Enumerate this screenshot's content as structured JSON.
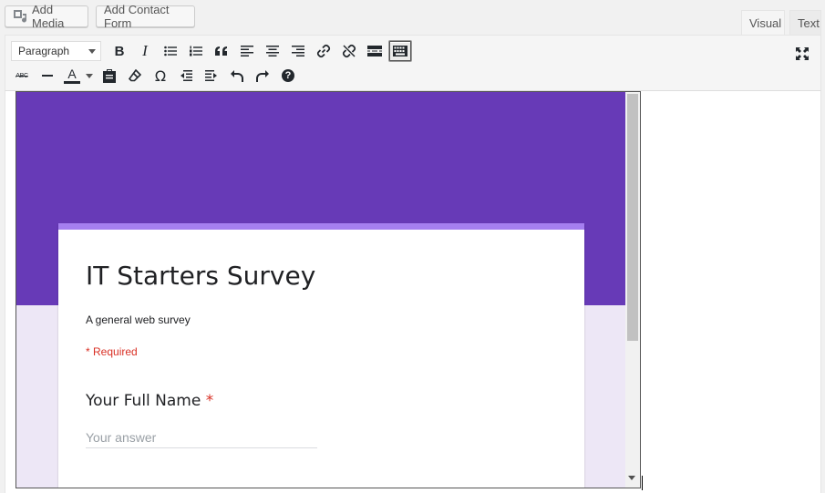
{
  "topbar": {
    "add_media_label": "Add Media",
    "add_contact_form_label": "Add Contact Form"
  },
  "tabs": [
    {
      "label": "Visual",
      "active": true
    },
    {
      "label": "Text",
      "active": false
    }
  ],
  "toolbar": {
    "format_select_value": "Paragraph",
    "row1_icons": [
      "bold-icon",
      "italic-icon",
      "bulleted-list-icon",
      "numbered-list-icon",
      "blockquote-icon",
      "align-left-icon",
      "align-center-icon",
      "align-right-icon",
      "insert-link-icon",
      "remove-link-icon",
      "read-more-icon",
      "toolbar-toggle-icon"
    ],
    "row2_icons": [
      "strikethrough-icon",
      "horizontal-line-icon",
      "text-color-icon",
      "paste-as-text-icon",
      "clear-formatting-icon",
      "special-character-icon",
      "decrease-indent-icon",
      "increase-indent-icon",
      "undo-icon",
      "redo-icon",
      "help-icon"
    ],
    "fullscreen_icon": "distraction-free-icon",
    "bold_glyph": "B",
    "italic_glyph": "I",
    "strike_glyph": "ABC",
    "text_color_glyph": "A",
    "omega_glyph": "Ω",
    "help_glyph": "?"
  },
  "form": {
    "title": "IT Starters Survey",
    "description": "A general web survey",
    "required_note": "* Required",
    "question": "Your Full Name",
    "required_star": "*",
    "answer_placeholder": "Your answer"
  },
  "colors": {
    "banner": "#673ab7",
    "background": "#ede7f6",
    "card_accent": "#a57ff0",
    "required": "#d93025"
  }
}
